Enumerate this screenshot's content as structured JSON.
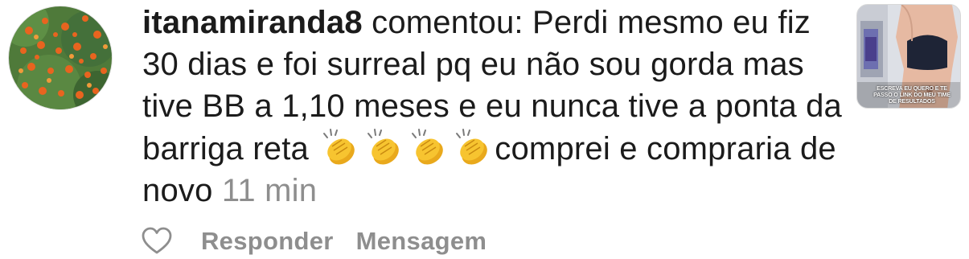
{
  "comment": {
    "username": "itanamiranda8",
    "verb": "comentou:",
    "text_part1": "Perdi mesmo eu fiz 30 dias e foi surreal pq eu não sou gorda mas tive BB a 1,10 meses e eu nunca tive a ponta da barriga reta",
    "emoji_name": "clapping-hands",
    "emoji_count": 4,
    "text_part2": "comprei e compraria de novo",
    "timestamp": "11 min"
  },
  "thumbnail": {
    "caption": "ESCREVA EU QUERO E TE PASSO O LINK DO MEU TIME DE RESULTADOS"
  },
  "actions": {
    "like_icon": "heart-icon",
    "reply_label": "Responder",
    "message_label": "Mensagem"
  },
  "colors": {
    "text": "#1b1b1b",
    "muted": "#8e8e8e",
    "emoji": "#f7c430"
  }
}
